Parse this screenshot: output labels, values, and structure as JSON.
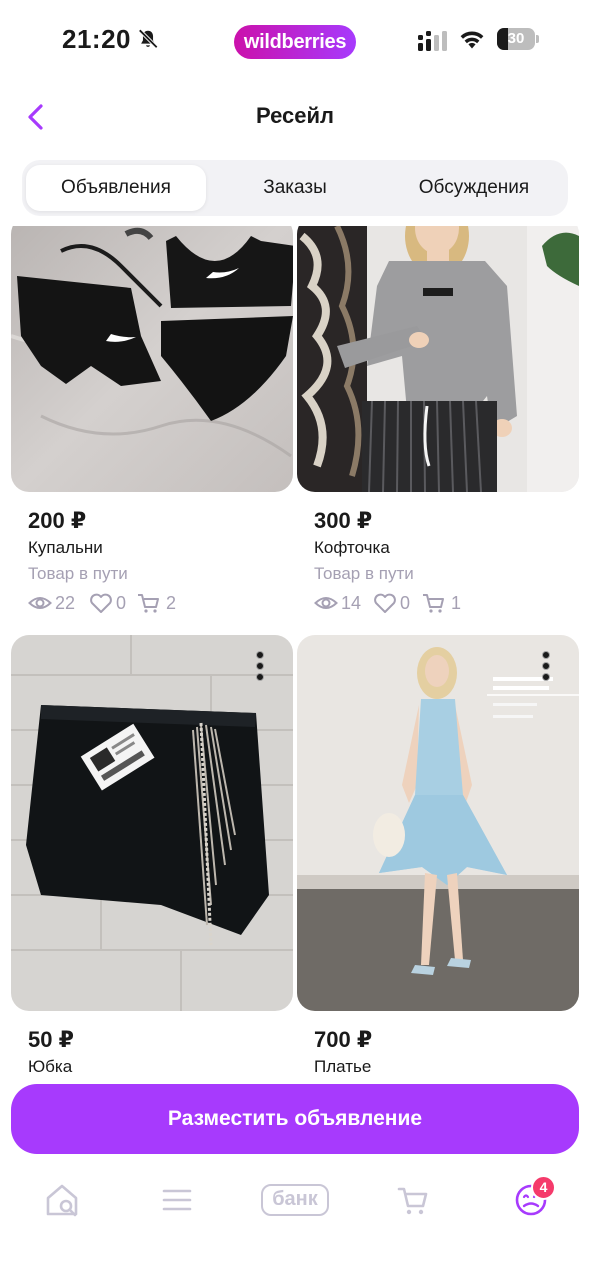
{
  "status_bar": {
    "time": "21:20",
    "brand": "wildberries",
    "battery_level": "30",
    "battery_fraction": 0.3,
    "icons": [
      "bell-muted-icon",
      "cellular-signal-icon",
      "wifi-icon",
      "battery-icon"
    ]
  },
  "header": {
    "title": "Ресейл",
    "back_icon": "chevron-left-icon"
  },
  "tabs": [
    {
      "label": "Объявления",
      "active": true
    },
    {
      "label": "Заказы",
      "active": false
    },
    {
      "label": "Обсуждения",
      "active": false
    }
  ],
  "listings": [
    {
      "price": "200 ₽",
      "name": "Купальни",
      "status": "Товар в пути",
      "views": "22",
      "likes": "0",
      "carts": "2",
      "image": "black sport swimsuit with skirt"
    },
    {
      "price": "300 ₽",
      "name": "Кофточка",
      "status": "Товар в пути",
      "views": "14",
      "likes": "0",
      "carts": "1",
      "image": "grey knit top on model"
    },
    {
      "price": "50 ₽",
      "name": "Юбка",
      "image": "black mini skirt with chain fringe"
    },
    {
      "price": "700 ₽",
      "name": "Платье",
      "image": "light blue lace dress on model"
    }
  ],
  "cta": {
    "label": "Разместить объявление"
  },
  "bottom_nav": {
    "items": [
      "home-search-icon",
      "menu-icon",
      "bank-icon",
      "cart-icon",
      "profile-icon"
    ],
    "bank_label": "банк",
    "profile_badge": "4"
  },
  "colors": {
    "accent": "#a73afd",
    "brand_gradient_start": "#cb11ab",
    "brand_gradient_end": "#a73afd",
    "muted_text": "#a5a0b3",
    "badge": "#f53a6b",
    "tab_background": "#f2f2f5"
  }
}
